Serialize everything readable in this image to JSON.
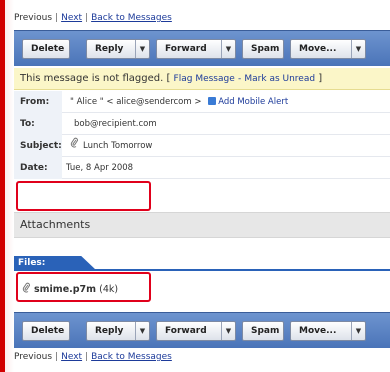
{
  "nav": {
    "previous": "Previous",
    "next": "Next",
    "back": "Back to Messages",
    "separator": "|"
  },
  "toolbar": {
    "delete": "Delete",
    "reply": "Reply",
    "forward": "Forward",
    "spam": "Spam",
    "move": "Move...",
    "caret": "▼"
  },
  "flag": {
    "status": "This message is not flagged.",
    "open_bracket": "[",
    "flag_link": "Flag Message",
    "dash": "-",
    "unread_link": "Mark as Unread",
    "close_bracket": "]"
  },
  "headers": {
    "from_label": "From:",
    "from_value": "\" Alice \" < alice@sendercom >",
    "add_alert": "Add Mobile Alert",
    "to_label": "To:",
    "to_value": "bob@recipient.com",
    "subject_label": "Subject:",
    "subject_value": "Lunch Tomorrow",
    "date_label": "Date:",
    "date_value": "Tue, 8 Apr 2008"
  },
  "attachments": {
    "title": "Attachments",
    "files_tab": "Files:",
    "file_name": "smime.p7m",
    "file_size": "(4k)"
  },
  "colors": {
    "accent": "#2a62b8",
    "toolbar": "#5a80c2",
    "highlight_box": "#e0001b",
    "flag_bg": "#fbf6c8"
  }
}
